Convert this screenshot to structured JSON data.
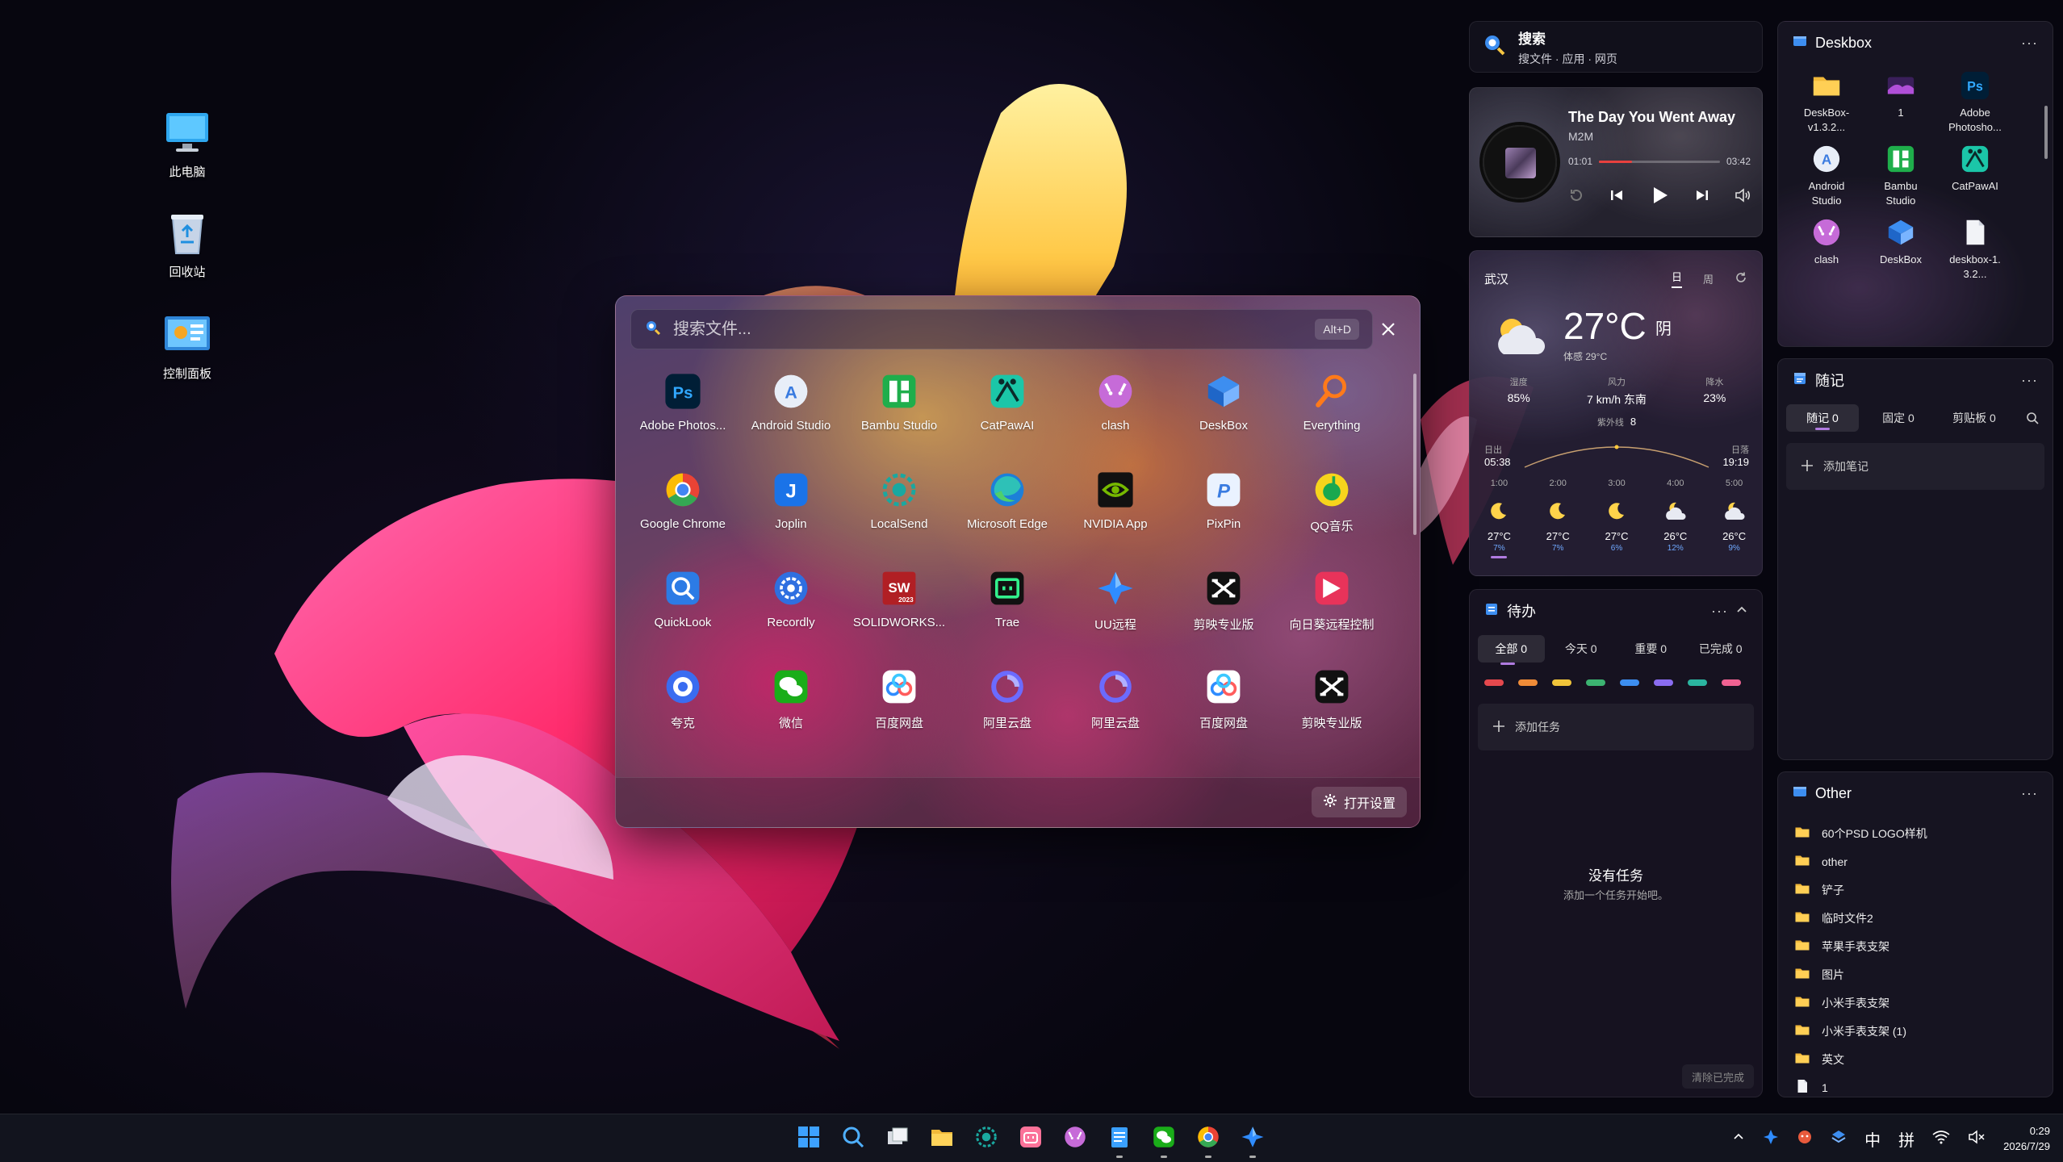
{
  "desktop": {
    "icons": [
      {
        "label": "此电脑",
        "icon": "computer-icon"
      },
      {
        "label": "回收站",
        "icon": "recycle-bin-icon"
      },
      {
        "label": "控制面板",
        "icon": "control-panel-icon"
      }
    ]
  },
  "launcher": {
    "search_placeholder": "搜索文件...",
    "shortcut": "Alt+D",
    "open_settings_label": "打开设置",
    "apps": [
      {
        "label": "Adobe Photos...",
        "icon": "photoshop-icon",
        "glyph": "Ps",
        "bg": "#001e36",
        "fg": "#31a8ff"
      },
      {
        "label": "Android Studio",
        "icon": "android-studio-icon",
        "glyph": "A",
        "bg": "#e8eef8",
        "fg": "#3a7be0"
      },
      {
        "label": "Bambu Studio",
        "icon": "bambu-studio-icon",
        "glyph": "▚",
        "bg": "#1fae4b",
        "fg": "#ffffff"
      },
      {
        "label": "CatPawAI",
        "icon": "catpaw-icon",
        "glyph": "✦",
        "bg": "#1bc6a8",
        "fg": "#0b2a2a"
      },
      {
        "label": "clash",
        "icon": "clash-icon",
        "glyph": "🐱",
        "bg": "#c66bd8",
        "fg": "#ffffff"
      },
      {
        "label": "DeskBox",
        "icon": "deskbox-icon",
        "glyph": "◆",
        "bg": "transparent",
        "fg": "#3d8ef0"
      },
      {
        "label": "Everything",
        "icon": "everything-icon",
        "glyph": "⌕",
        "bg": "transparent",
        "fg": "#ff7a1a"
      },
      {
        "label": "Google Chrome",
        "icon": "chrome-icon",
        "glyph": "◉",
        "bg": "transparent",
        "fg": "#ea4335"
      },
      {
        "label": "Joplin",
        "icon": "joplin-icon",
        "glyph": "J",
        "bg": "#1a73e8",
        "fg": "#ffffff"
      },
      {
        "label": "LocalSend",
        "icon": "localsend-icon",
        "glyph": "◎",
        "bg": "transparent",
        "fg": "#1aa8a0"
      },
      {
        "label": "Microsoft Edge",
        "icon": "edge-icon",
        "glyph": "e",
        "bg": "transparent",
        "fg": "#2ec1b7"
      },
      {
        "label": "NVIDIA App",
        "icon": "nvidia-icon",
        "glyph": "◐",
        "bg": "#111111",
        "fg": "#76b900"
      },
      {
        "label": "PixPin",
        "icon": "pixpin-icon",
        "glyph": "P",
        "bg": "#eaf2ff",
        "fg": "#3a7be0"
      },
      {
        "label": "QQ音乐",
        "icon": "qq-music-icon",
        "glyph": "♪",
        "bg": "#f7d41c",
        "fg": "#1aa84f"
      },
      {
        "label": "QuickLook",
        "icon": "quicklook-icon",
        "glyph": "⌕",
        "bg": "#2c7be5",
        "fg": "#ffffff"
      },
      {
        "label": "Recordly",
        "icon": "recordly-icon",
        "glyph": "⚙",
        "bg": "#2f6fe0",
        "fg": "#ffffff"
      },
      {
        "label": "SOLIDWORKS...",
        "icon": "solidworks-icon",
        "glyph": "SW",
        "bg": "#b11f24",
        "fg": "#ffffff"
      },
      {
        "label": "Trae",
        "icon": "trae-icon",
        "glyph": "▭",
        "bg": "#111111",
        "fg": "#32f08c"
      },
      {
        "label": "UU远程",
        "icon": "uu-remote-icon",
        "glyph": "✦",
        "bg": "transparent",
        "fg": "#2f8cff"
      },
      {
        "label": "剪映专业版",
        "icon": "capcut-icon",
        "glyph": "✂",
        "bg": "#111111",
        "fg": "#ffffff"
      },
      {
        "label": "向日葵远程控制",
        "icon": "sunlogin-icon",
        "glyph": "◣",
        "bg": "#e8335a",
        "fg": "#ffffff"
      },
      {
        "label": "夸克",
        "icon": "quark-icon",
        "glyph": "◔",
        "bg": "#3a6cf0",
        "fg": "#ffffff"
      },
      {
        "label": "微信",
        "icon": "wechat-icon",
        "glyph": "💬",
        "bg": "#1aad19",
        "fg": "#ffffff"
      },
      {
        "label": "百度网盘",
        "icon": "baidu-netdisk-icon",
        "glyph": "☁",
        "bg": "#ffffff",
        "fg": "#2f8cff"
      },
      {
        "label": "阿里云盘",
        "icon": "aliyun-drive-icon",
        "glyph": "◯",
        "bg": "transparent",
        "fg": "#6b6bff"
      },
      {
        "label": "阿里云盘",
        "icon": "aliyun-drive-icon",
        "glyph": "◯",
        "bg": "transparent",
        "fg": "#6b6bff"
      },
      {
        "label": "百度网盘",
        "icon": "baidu-netdisk-icon",
        "glyph": "☁",
        "bg": "#ffffff",
        "fg": "#2f8cff"
      },
      {
        "label": "剪映专业版",
        "icon": "capcut-icon",
        "glyph": "✂",
        "bg": "#111111",
        "fg": "#ffffff"
      }
    ]
  },
  "search_widget": {
    "title": "搜索",
    "subtitle": "搜文件 · 应用 · 网页"
  },
  "music": {
    "song": "The Day You Went Away",
    "artist": "M2M",
    "elapsed": "01:01",
    "duration": "03:42",
    "progress": 0.27,
    "accent": "#e8403e"
  },
  "weather": {
    "city": "武汉",
    "tabs": [
      "日",
      "周"
    ],
    "temp": "27°C",
    "condition": "阴",
    "feels_like": "体感 29°C",
    "stats": [
      {
        "k": "湿度",
        "v": "85%"
      },
      {
        "k": "风力",
        "v": "7 km/h 东南"
      },
      {
        "k": "降水",
        "v": "23%"
      }
    ],
    "uv_label": "紫外线",
    "uv_value": "8",
    "sunrise_label": "日出",
    "sunrise": "05:38",
    "sunset_label": "日落",
    "sunset": "19:19",
    "hours": [
      {
        "h": "1:00",
        "icon": "moon-icon",
        "t": "27°C",
        "p": "7%"
      },
      {
        "h": "2:00",
        "icon": "moon-icon",
        "t": "27°C",
        "p": "7%"
      },
      {
        "h": "3:00",
        "icon": "moon-icon",
        "t": "27°C",
        "p": "6%"
      },
      {
        "h": "4:00",
        "icon": "cloudy-night-icon",
        "t": "26°C",
        "p": "12%"
      },
      {
        "h": "5:00",
        "icon": "cloudy-night-icon",
        "t": "26°C",
        "p": "9%"
      }
    ]
  },
  "todo": {
    "title": "待办",
    "tabs": [
      "全部 0",
      "今天 0",
      "重要 0",
      "已完成 0"
    ],
    "colors": [
      "#e5484d",
      "#f08c38",
      "#f0c43a",
      "#3cb371",
      "#3d8ef0",
      "#8a6cf0",
      "#2bb5a0",
      "#f06292"
    ],
    "add_label": "添加任务",
    "empty_title": "没有任务",
    "empty_sub": "添加一个任务开始吧。",
    "clear_label": "清除已完成"
  },
  "deskbox": {
    "title": "Deskbox",
    "items": [
      {
        "label": "DeskBox-\nv1.3.2...",
        "icon": "folder-icon"
      },
      {
        "label": "1",
        "icon": "image-thumb-icon"
      },
      {
        "label": "Adobe\nPhotosho...",
        "icon": "photoshop-icon"
      },
      {
        "label": "Android\nStudio",
        "icon": "android-studio-icon"
      },
      {
        "label": "Bambu\nStudio",
        "icon": "bambu-studio-icon"
      },
      {
        "label": "CatPawAI",
        "icon": "catpaw-icon"
      },
      {
        "label": "clash",
        "icon": "clash-icon"
      },
      {
        "label": "DeskBox",
        "icon": "deskbox-icon"
      },
      {
        "label": "deskbox-1.\n3.2...",
        "icon": "file-icon"
      }
    ]
  },
  "notes": {
    "title": "随记",
    "tabs": [
      "随记 0",
      "固定 0",
      "剪贴板 0"
    ],
    "add_label": "添加笔记"
  },
  "other": {
    "title": "Other",
    "items": [
      {
        "label": "60个PSD LOGO样机",
        "icon": "folder-icon"
      },
      {
        "label": "other",
        "icon": "folder-icon"
      },
      {
        "label": "铲子",
        "icon": "folder-icon"
      },
      {
        "label": "临时文件2",
        "icon": "folder-icon"
      },
      {
        "label": "苹果手表支架",
        "icon": "folder-icon"
      },
      {
        "label": "图片",
        "icon": "folder-icon"
      },
      {
        "label": "小米手表支架",
        "icon": "folder-icon"
      },
      {
        "label": "小米手表支架 (1)",
        "icon": "folder-icon"
      },
      {
        "label": "英文",
        "icon": "folder-icon"
      },
      {
        "label": "1",
        "icon": "file-icon"
      }
    ]
  },
  "taskbar": {
    "apps": [
      {
        "icon": "windows-start-icon"
      },
      {
        "icon": "search-icon"
      },
      {
        "icon": "task-view-icon"
      },
      {
        "icon": "file-explorer-icon"
      },
      {
        "icon": "localsend-icon"
      },
      {
        "icon": "bilibili-icon"
      },
      {
        "icon": "clash-icon"
      },
      {
        "icon": "notepad-icon"
      },
      {
        "icon": "wechat-icon"
      },
      {
        "icon": "chrome-icon"
      },
      {
        "icon": "uu-remote-icon"
      }
    ],
    "ime_lang": "中",
    "ime_mode": "拼",
    "time": "0:29",
    "date": "2026/7/29"
  }
}
